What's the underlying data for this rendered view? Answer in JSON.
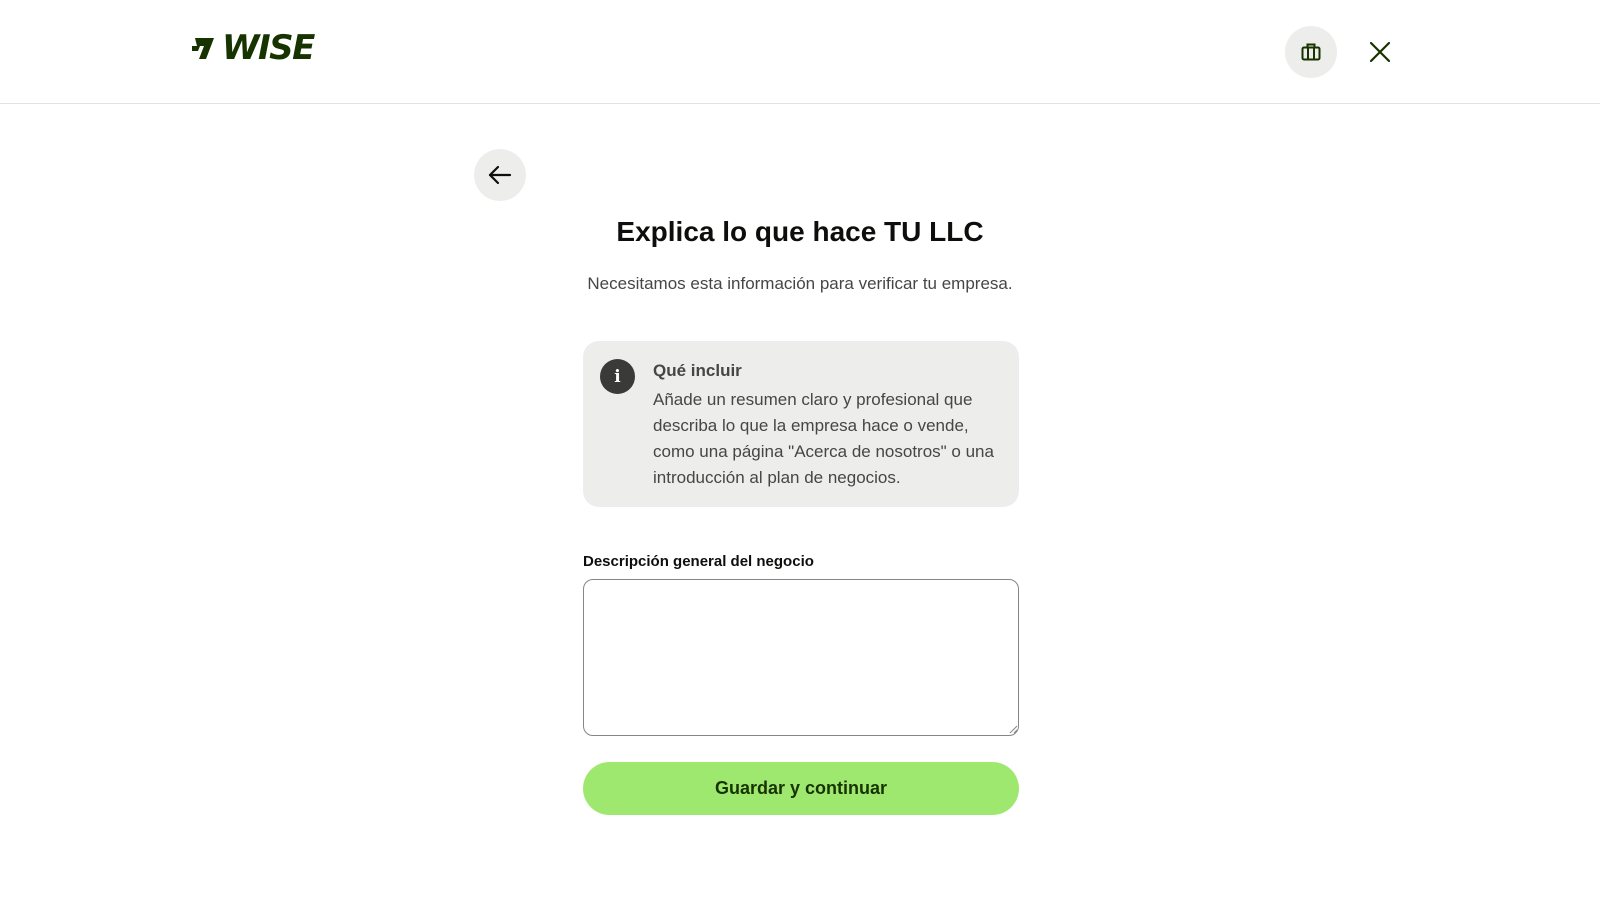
{
  "header": {
    "brand": "WISE",
    "business_icon": "briefcase-icon",
    "close_icon": "close-icon"
  },
  "nav": {
    "back_icon": "arrow-left-icon"
  },
  "page": {
    "title": "Explica lo que hace TU LLC",
    "subtitle": "Necesitamos esta información para verificar tu empresa."
  },
  "info_card": {
    "icon": "info-icon",
    "icon_glyph": "i",
    "title": "Qué incluir",
    "body": "Añade un resumen claro y profesional que describa lo que la empresa hace o vende, como una página \"Acerca de nosotros\" o una introducción al plan de negocios."
  },
  "form": {
    "field_label": "Descripción general del negocio",
    "field_value": "",
    "submit_label": "Guardar y continuar"
  },
  "colors": {
    "brand_dark_green": "#163300",
    "accent_green": "#9fe870",
    "neutral_bg": "#ededeb",
    "text_primary": "#0e0f0c",
    "text_secondary": "#454745"
  }
}
